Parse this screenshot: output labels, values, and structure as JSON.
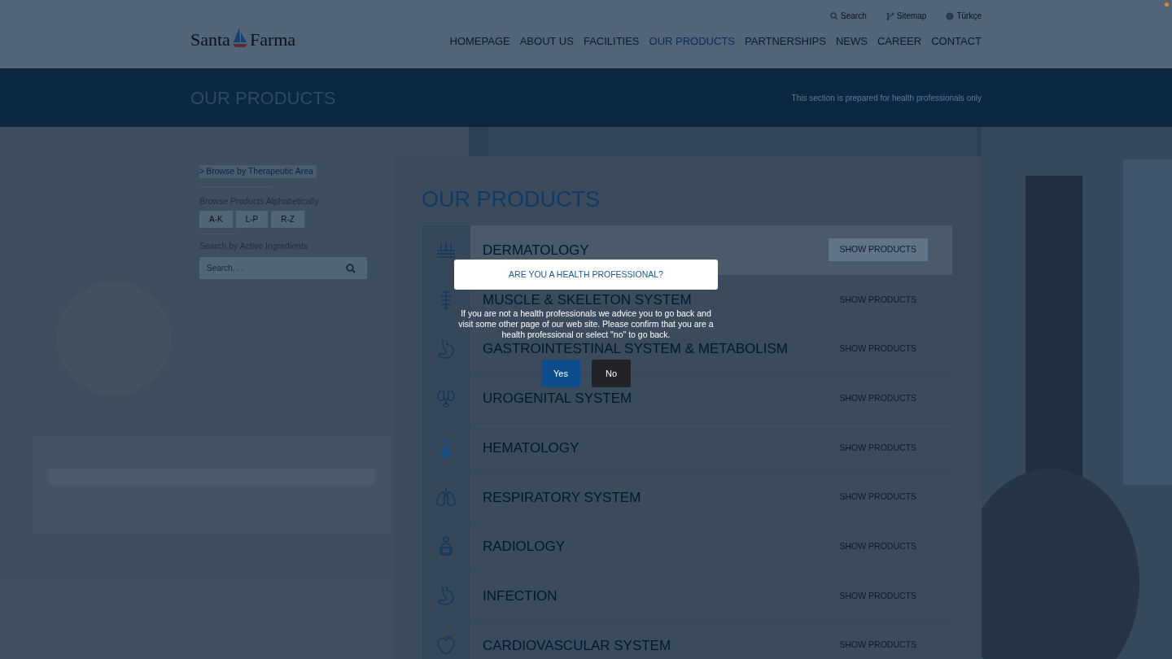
{
  "header": {
    "logo": {
      "word_1": "Santa",
      "word_2": "Farma"
    },
    "utility_links": [
      {
        "kind": "search",
        "label": "Search"
      },
      {
        "kind": "sitemap",
        "label": "Sitemap"
      },
      {
        "kind": "language",
        "label": "Türkçe"
      }
    ],
    "nav": [
      {
        "label": "HOMEPAGE",
        "selected": false
      },
      {
        "label": "ABOUT US",
        "selected": false
      },
      {
        "label": "FACILITIES",
        "selected": false
      },
      {
        "label": "OUR PRODUCTS",
        "selected": true
      },
      {
        "label": "PARTNERSHIPS",
        "selected": false
      },
      {
        "label": "NEWS",
        "selected": false
      },
      {
        "label": "CAREER",
        "selected": false
      },
      {
        "label": "CONTACT",
        "selected": false
      }
    ]
  },
  "banner": {
    "title": "OUR PRODUCTS",
    "note": "This section is prepared for health professionals only"
  },
  "sidebar": {
    "browse_link": {
      "icon": ">",
      "label": "Browse by Therapeutic Area"
    },
    "alphabet_heading": "Browse Products Alphabetically",
    "alphabet_ranges": [
      "A-K",
      "L-P",
      "R-Z"
    ],
    "search_heading": "Search by Active Ingredients",
    "search": {
      "placeholder": "Search. . ."
    }
  },
  "products": {
    "title": "OUR PRODUCTS",
    "areas": [
      {
        "kind": "skin",
        "name": "DERMATOLOGY",
        "action": "SHOW PRODUCTS",
        "selected": true
      },
      {
        "kind": "spine",
        "name": "MUSCLE & SKELETON SYSTEM",
        "action": "SHOW PRODUCTS",
        "selected": false
      },
      {
        "kind": "stomach",
        "name": "GASTROINTESTINAL SYSTEM & METABOLISM",
        "action": "SHOW PRODUCTS",
        "selected": false
      },
      {
        "kind": "kidney",
        "name": "UROGENITAL SYSTEM",
        "action": "SHOW PRODUCTS",
        "selected": false
      },
      {
        "kind": "drop",
        "name": "HEMATOLOGY",
        "action": "SHOW PRODUCTS",
        "selected": false
      },
      {
        "kind": "lungs",
        "name": "RESPIRATORY SYSTEM",
        "action": "SHOW PRODUCTS",
        "selected": false
      },
      {
        "kind": "person",
        "name": "RADIOLOGY",
        "action": "SHOW PRODUCTS",
        "selected": false
      },
      {
        "kind": "stomach",
        "name": "INFECTION",
        "action": "SHOW PRODUCTS",
        "selected": false
      },
      {
        "kind": "heart",
        "name": "CARDIOVASCULAR SYSTEM",
        "action": "SHOW PRODUCTS",
        "selected": false
      }
    ]
  },
  "dialog": {
    "title": "ARE YOU A HEALTH PROFESSIONAL?",
    "message": "If you are not a health professionals we advice you to go back and visit some other page of our web site. Please confirm that you are a health professional or select \"no\" to go back.",
    "buttons": [
      {
        "kind": "confirm",
        "label": "Yes"
      },
      {
        "kind": "cancel",
        "label": "No"
      }
    ]
  }
}
